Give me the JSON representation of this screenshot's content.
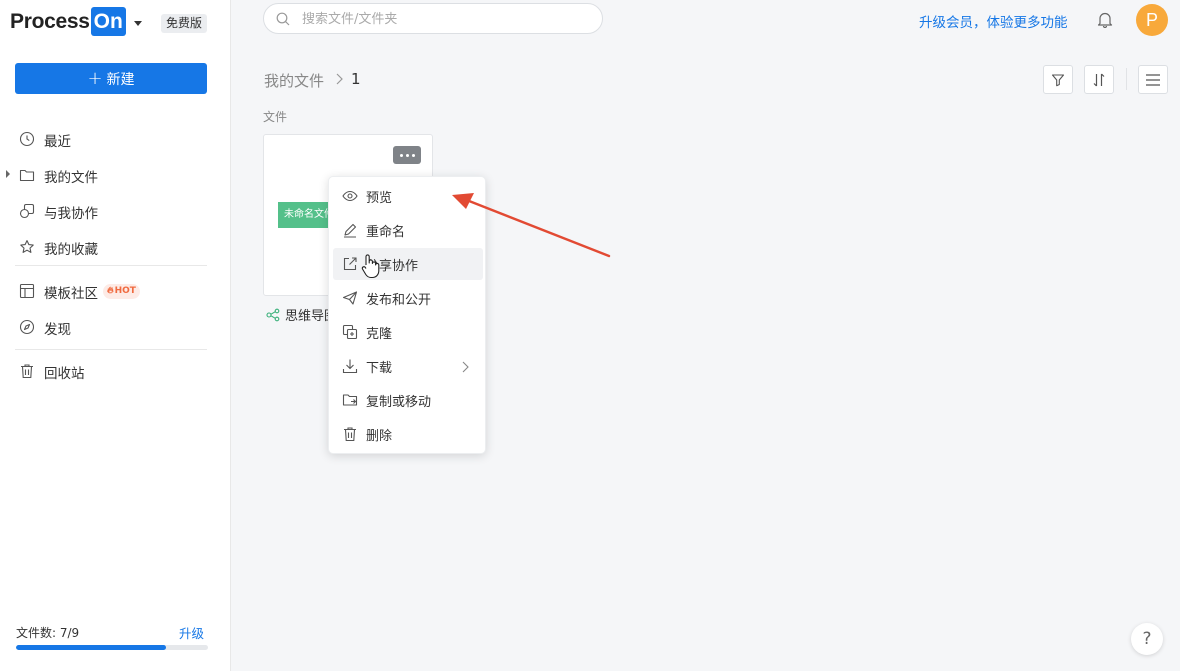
{
  "brand": {
    "name_prefix": "Process",
    "name_suffix": "On",
    "plan": "免费版",
    "accent": "#1677e6"
  },
  "sidebar": {
    "new_button": "新建",
    "items": [
      {
        "label": "最近",
        "icon": "clock-icon"
      },
      {
        "label": "我的文件",
        "icon": "folder-icon"
      },
      {
        "label": "与我协作",
        "icon": "collab-icon"
      },
      {
        "label": "我的收藏",
        "icon": "star-icon"
      },
      {
        "label": "模板社区",
        "icon": "template-icon",
        "badge": "HOT"
      },
      {
        "label": "发现",
        "icon": "compass-icon"
      },
      {
        "label": "回收站",
        "icon": "trash-icon"
      }
    ],
    "footer": {
      "count_label": "文件数: 7/9",
      "upgrade": "升级",
      "used_fraction": 0.78
    }
  },
  "header": {
    "search_placeholder": "搜索文件/文件夹",
    "upgrade_link": "升级会员，体验更多功能",
    "avatar_initial": "P"
  },
  "breadcrumb": {
    "root": "我的文件",
    "current": "1"
  },
  "content": {
    "section_label": "文件",
    "file": {
      "thumb_text": "未命名文件",
      "title": "思维导图"
    }
  },
  "context_menu": {
    "items": [
      {
        "label": "预览",
        "icon": "eye-icon"
      },
      {
        "label": "重命名",
        "icon": "pencil-icon"
      },
      {
        "label": "分享协作",
        "icon": "share-icon"
      },
      {
        "label": "发布和公开",
        "icon": "send-icon"
      },
      {
        "label": "克隆",
        "icon": "clone-icon"
      },
      {
        "label": "下载",
        "icon": "download-icon"
      },
      {
        "label": "复制或移动",
        "icon": "move-icon"
      },
      {
        "label": "删除",
        "icon": "trash-icon"
      }
    ]
  },
  "help": "?"
}
